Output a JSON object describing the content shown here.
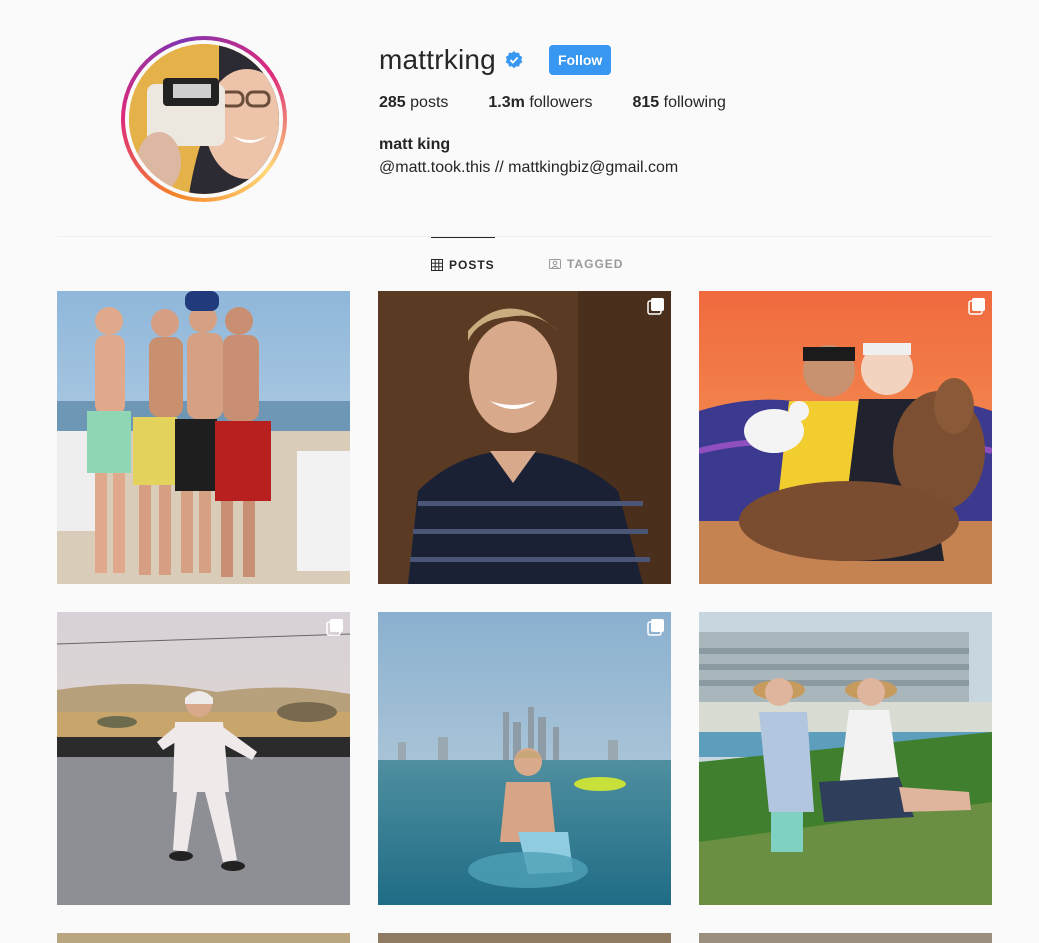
{
  "profile": {
    "username": "mattrking",
    "follow_label": "Follow",
    "full_name": "matt king",
    "bio": "@matt.took.this // mattkingbiz@gmail.com",
    "stats": {
      "posts_count": "285",
      "posts_label": "posts",
      "followers_count": "1.3m",
      "followers_label": "followers",
      "following_count": "815",
      "following_label": "following"
    }
  },
  "tabs": [
    {
      "label": "POSTS",
      "icon": "grid-icon",
      "active": true
    },
    {
      "label": "TAGGED",
      "icon": "tagged-icon",
      "active": false
    }
  ],
  "colors": {
    "accent": "#3897f0",
    "verified": "#3897f0",
    "text": "#262626",
    "muted": "#999999"
  },
  "posts": [
    {
      "subject": "four friends at beach",
      "multi": false
    },
    {
      "subject": "portrait striped sweater",
      "multi": true
    },
    {
      "subject": "two men with duck and alpaca",
      "multi": true
    },
    {
      "subject": "man in white tracksuit desert road",
      "multi": true
    },
    {
      "subject": "man on inflatable in sea with skyline",
      "multi": true
    },
    {
      "subject": "two friends in bucket hats at resort",
      "multi": false
    }
  ]
}
